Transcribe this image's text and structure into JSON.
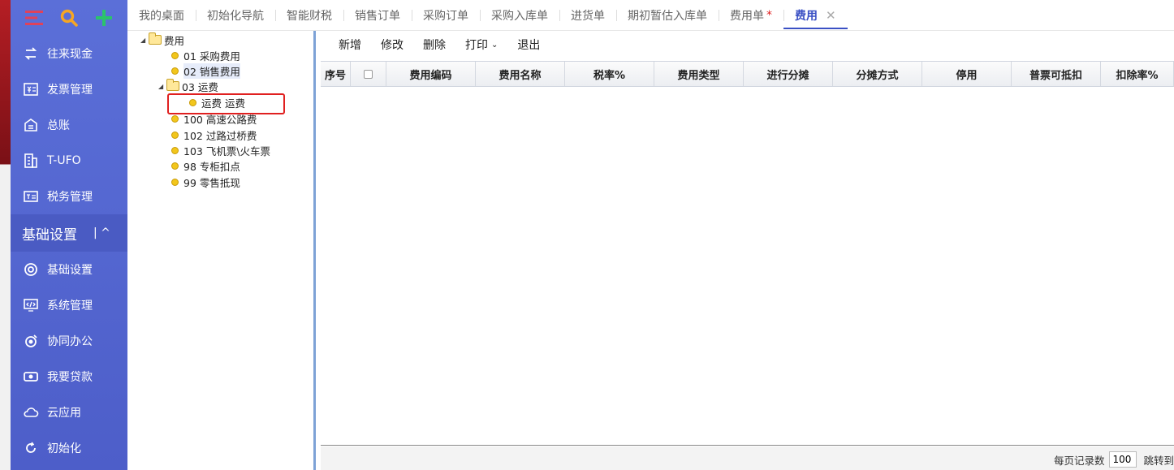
{
  "sidebar": {
    "top_icons": [
      "menu-icon",
      "search-icon",
      "plus-icon"
    ],
    "items_top": [
      {
        "label": "往来现金",
        "icon": "exchange-icon"
      },
      {
        "label": "发票管理",
        "icon": "invoice-icon"
      },
      {
        "label": "总账",
        "icon": "ledger-icon"
      },
      {
        "label": "T-UFO",
        "icon": "building-icon"
      },
      {
        "label": "税务管理",
        "icon": "tax-icon"
      }
    ],
    "group_label": "基础设置",
    "items_bottom": [
      {
        "label": "基础设置",
        "icon": "settings-icon"
      },
      {
        "label": "系统管理",
        "icon": "code-monitor-icon"
      },
      {
        "label": "协同办公",
        "icon": "collab-icon"
      },
      {
        "label": "我要贷款",
        "icon": "money-icon"
      },
      {
        "label": "云应用",
        "icon": "cloud-icon"
      },
      {
        "label": "初始化",
        "icon": "refresh-icon"
      }
    ]
  },
  "tabs": [
    {
      "label": "我的桌面"
    },
    {
      "label": "初始化导航"
    },
    {
      "label": "智能财税"
    },
    {
      "label": "销售订单"
    },
    {
      "label": "采购订单"
    },
    {
      "label": "采购入库单"
    },
    {
      "label": "进货单"
    },
    {
      "label": "期初暂估入库单"
    },
    {
      "label": "费用单",
      "modified": "*"
    },
    {
      "label": "费用",
      "active": true
    }
  ],
  "tree": {
    "root": "费用",
    "n1": "01 采购费用",
    "n2": "02 销售费用",
    "n3": "03 运费",
    "n3a": "运费 运费",
    "n4": "100 高速公路费",
    "n5": "102 过路过桥费",
    "n6": "103 飞机票\\火车票",
    "n7": "98 专柜扣点",
    "n8": "99 零售抵现"
  },
  "toolbar": {
    "add": "新增",
    "edit": "修改",
    "delete": "删除",
    "print": "打印",
    "exit": "退出"
  },
  "grid": {
    "columns": [
      "序号",
      "",
      "费用编码",
      "费用名称",
      "税率%",
      "费用类型",
      "进行分摊",
      "分摊方式",
      "停用",
      "普票可抵扣",
      "扣除率%"
    ]
  },
  "footer": {
    "per_page_label": "每页记录数",
    "per_page_value": "100",
    "jump_label": "跳转到"
  }
}
